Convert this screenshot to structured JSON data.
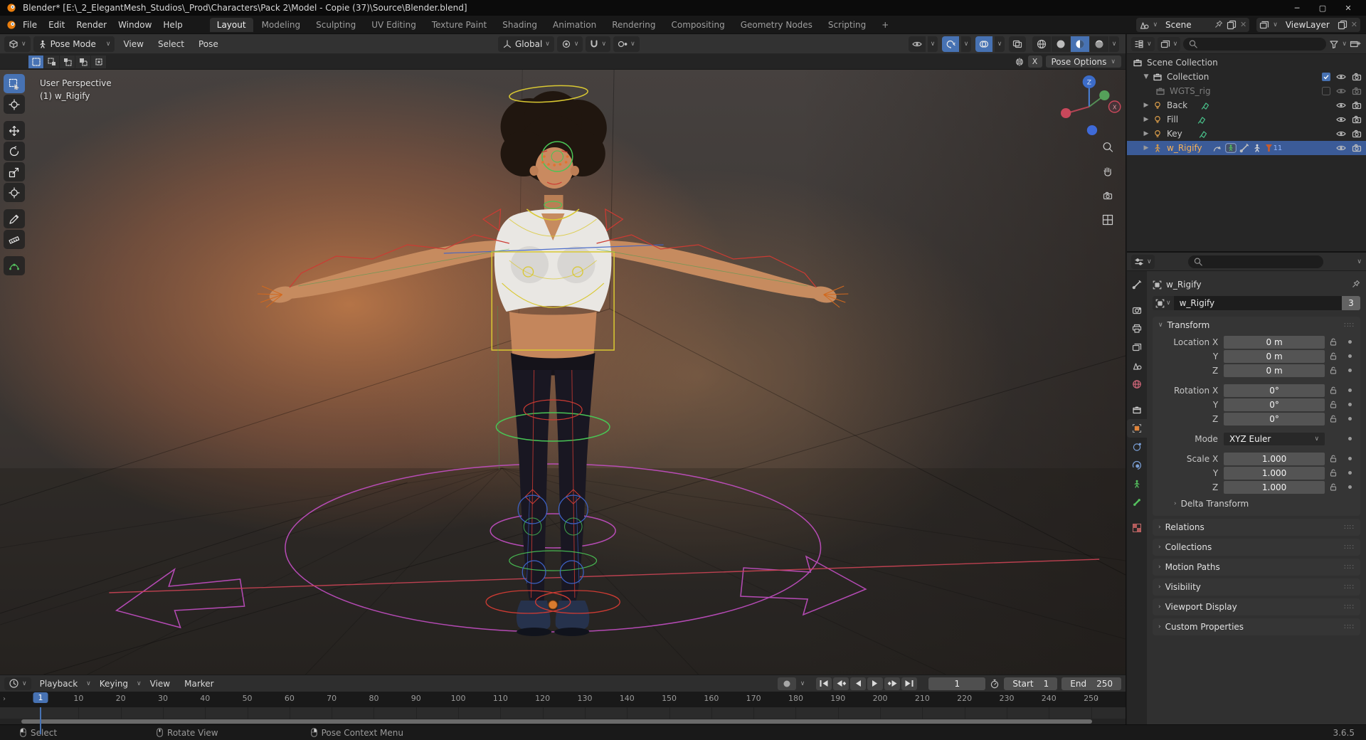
{
  "titlebar": {
    "title": "Blender* [E:\\_2_ElegantMesh_Studios\\_Prod\\Characters\\Pack 2\\Model - Copie (37)\\Source\\Blender.blend]"
  },
  "topbar": {
    "menus": [
      "File",
      "Edit",
      "Render",
      "Window",
      "Help"
    ],
    "tabs": [
      "Layout",
      "Modeling",
      "Sculpting",
      "UV Editing",
      "Texture Paint",
      "Shading",
      "Animation",
      "Rendering",
      "Compositing",
      "Geometry Nodes",
      "Scripting"
    ],
    "active_tab": "Layout",
    "add_tab": "+",
    "scene_label": "Scene",
    "viewlayer_label": "ViewLayer"
  },
  "vp_header": {
    "mode": "Pose Mode",
    "menus": [
      "View",
      "Select",
      "Pose"
    ],
    "orientation": "Global",
    "mirror_label": "X",
    "pose_options_label": "Pose Options"
  },
  "viewport": {
    "view_label": "User Perspective",
    "object_label": "(1) w_Rigify",
    "gizmo_z": "Z",
    "gizmo_x": "X"
  },
  "outliner": {
    "rows": [
      {
        "label": "Scene Collection"
      },
      {
        "label": "Collection"
      },
      {
        "label": "WGTS_rig"
      },
      {
        "label": "Back"
      },
      {
        "label": "Fill"
      },
      {
        "label": "Key"
      },
      {
        "label": "w_Rigify",
        "badge": "11"
      }
    ]
  },
  "properties": {
    "breadcrumb": "w_Rigify",
    "name_field": "w_Rigify",
    "users_count": "3",
    "transform_title": "Transform",
    "rows": [
      {
        "label": "Location X",
        "value": "0 m"
      },
      {
        "label": "Y",
        "value": "0 m"
      },
      {
        "label": "Z",
        "value": "0 m"
      },
      {
        "label": "Rotation X",
        "value": "0°"
      },
      {
        "label": "Y",
        "value": "0°"
      },
      {
        "label": "Z",
        "value": "0°"
      }
    ],
    "mode_label": "Mode",
    "mode_value": "XYZ Euler",
    "scale_rows": [
      {
        "label": "Scale X",
        "value": "1.000"
      },
      {
        "label": "Y",
        "value": "1.000"
      },
      {
        "label": "Z",
        "value": "1.000"
      }
    ],
    "subpanel": "Delta Transform",
    "panels": [
      "Relations",
      "Collections",
      "Motion Paths",
      "Visibility",
      "Viewport Display",
      "Custom Properties"
    ]
  },
  "timeline": {
    "menus": [
      "Playback",
      "Keying",
      "View",
      "Marker"
    ],
    "playhead_frame": "1",
    "current_frame": "1",
    "start_label": "Start",
    "start_value": "1",
    "end_label": "End",
    "end_value": "250",
    "ticks": [
      10,
      20,
      30,
      40,
      50,
      60,
      70,
      80,
      90,
      100,
      110,
      120,
      130,
      140,
      150,
      160,
      170,
      180,
      190,
      200,
      210,
      220,
      230,
      240,
      250
    ]
  },
  "statusbar": {
    "items": [
      "Select",
      "Rotate View",
      "Pose Context Menu"
    ],
    "version": "3.6.5"
  },
  "colors": {
    "accent": "#4772b3",
    "selection": "#3b5b98",
    "rig_yellow": "#d9c832",
    "rig_magenta": "#c44fc4",
    "rig_green": "#49c455",
    "rig_blue": "#3e63c8",
    "rig_red": "#cc3b33",
    "object_orange": "#e0853c"
  }
}
